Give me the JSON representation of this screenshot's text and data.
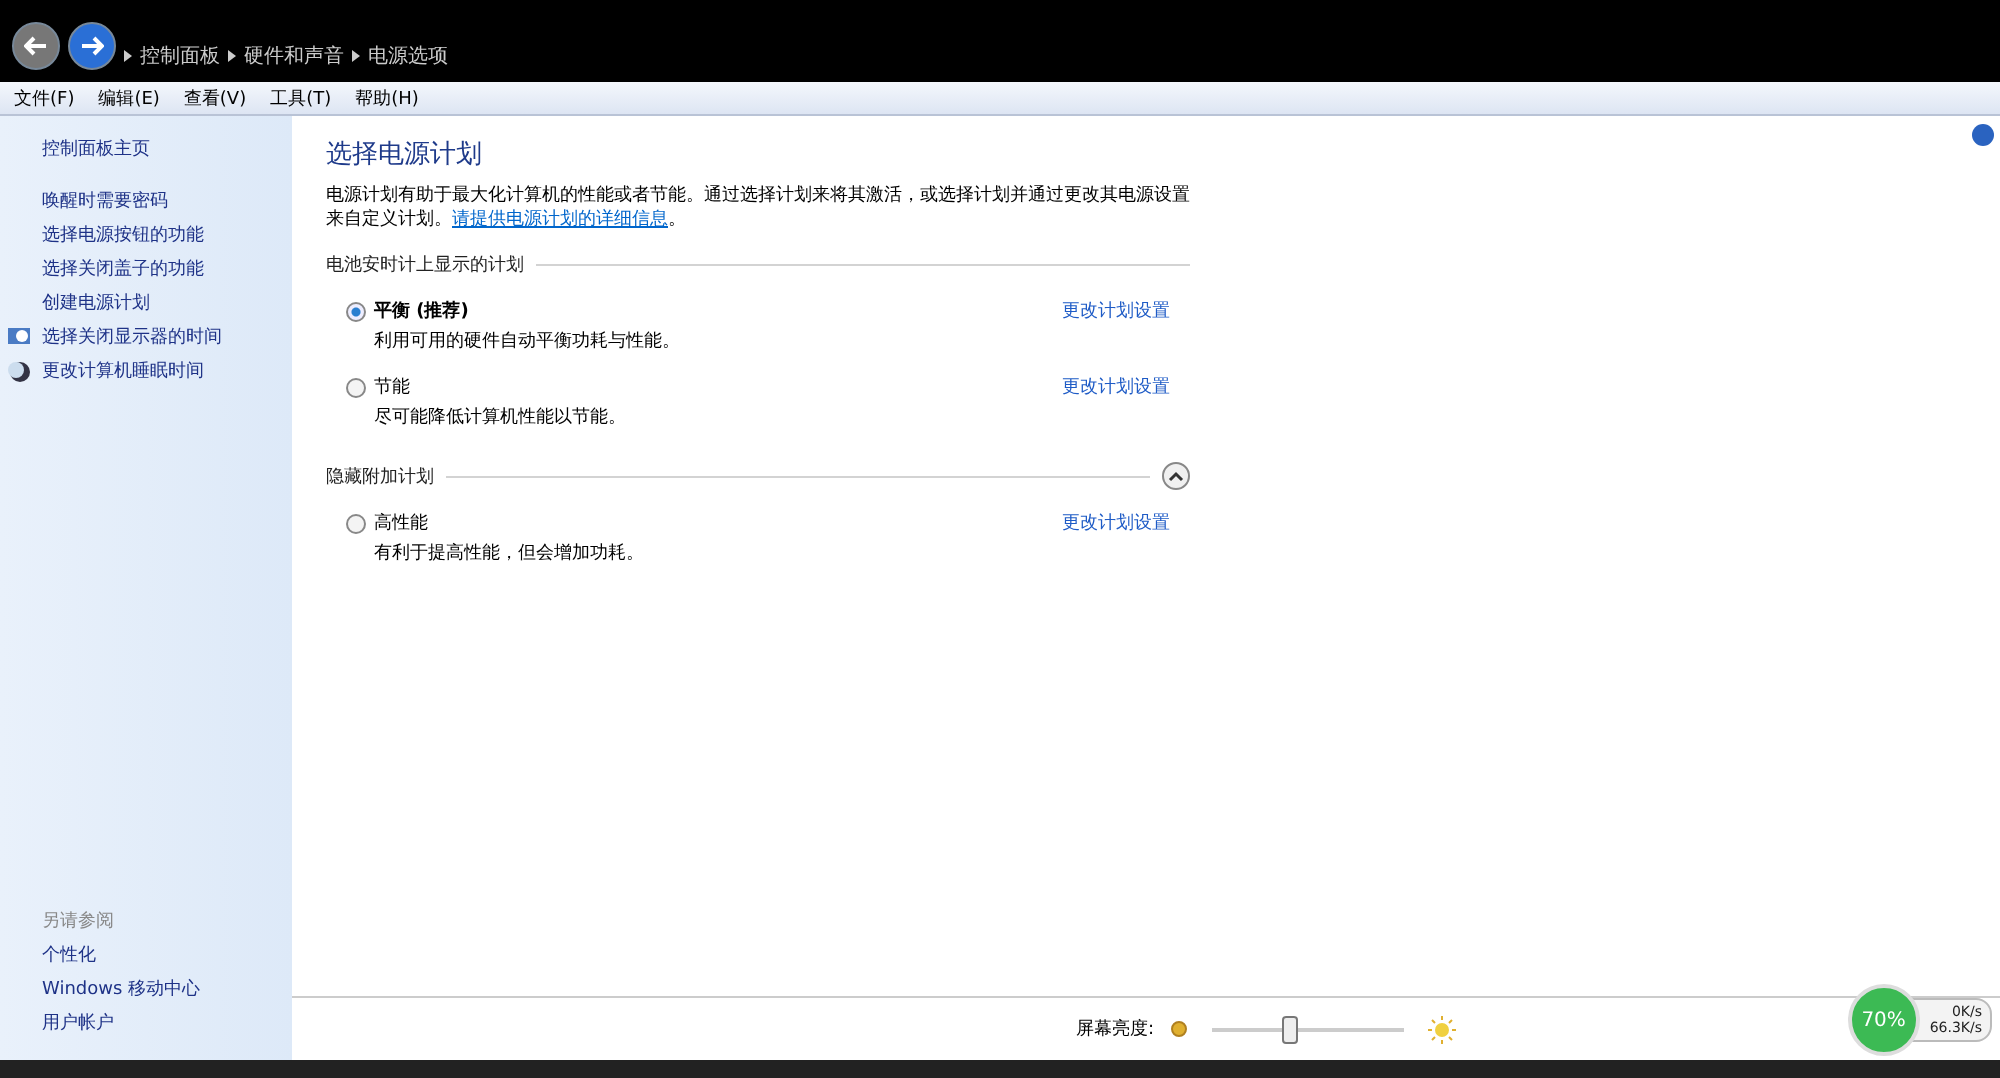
{
  "breadcrumb": [
    "控制面板",
    "硬件和声音",
    "电源选项"
  ],
  "menu": [
    "文件(F)",
    "编辑(E)",
    "查看(V)",
    "工具(T)",
    "帮助(H)"
  ],
  "sidebar": {
    "home": "控制面板主页",
    "items": [
      {
        "label": "唤醒时需要密码",
        "kind": "plain"
      },
      {
        "label": "选择电源按钮的功能",
        "kind": "plain"
      },
      {
        "label": "选择关闭盖子的功能",
        "kind": "plain"
      },
      {
        "label": "创建电源计划",
        "kind": "plain"
      },
      {
        "label": "选择关闭显示器的时间",
        "kind": "monitor"
      },
      {
        "label": "更改计算机睡眠时间",
        "kind": "moon"
      }
    ],
    "see_also_title": "另请参阅",
    "see_also": [
      "个性化",
      "Windows 移动中心",
      "用户帐户"
    ]
  },
  "content": {
    "title": "选择电源计划",
    "description": "电源计划有助于最大化计算机的性能或者节能。通过选择计划来将其激活，或选择计划并通过更改其电源设置来自定义计划。",
    "link": "请提供电源计划的详细信息",
    "link_end": "。",
    "groups": [
      {
        "title": "电池安时计上显示的计划",
        "plans": [
          {
            "name": "平衡 (推荐)",
            "selected": true,
            "description": "利用可用的硬件自动平衡功耗与性能。",
            "action": "更改计划设置"
          },
          {
            "name": "节能",
            "selected": false,
            "description": "尽可能降低计算机性能以节能。",
            "action": "更改计划设置"
          }
        ]
      },
      {
        "title": "隐藏附加计划",
        "expanded": true,
        "plans": [
          {
            "name": "高性能",
            "selected": false,
            "description": "有利于提高性能，但会增加功耗。",
            "action": "更改计划设置"
          }
        ]
      }
    ]
  },
  "brightness": {
    "label": "屏幕亮度:",
    "level": 0.4
  },
  "speed_widget": {
    "percent": "70%",
    "upload": "0K/s",
    "download": "66.3K/s"
  }
}
